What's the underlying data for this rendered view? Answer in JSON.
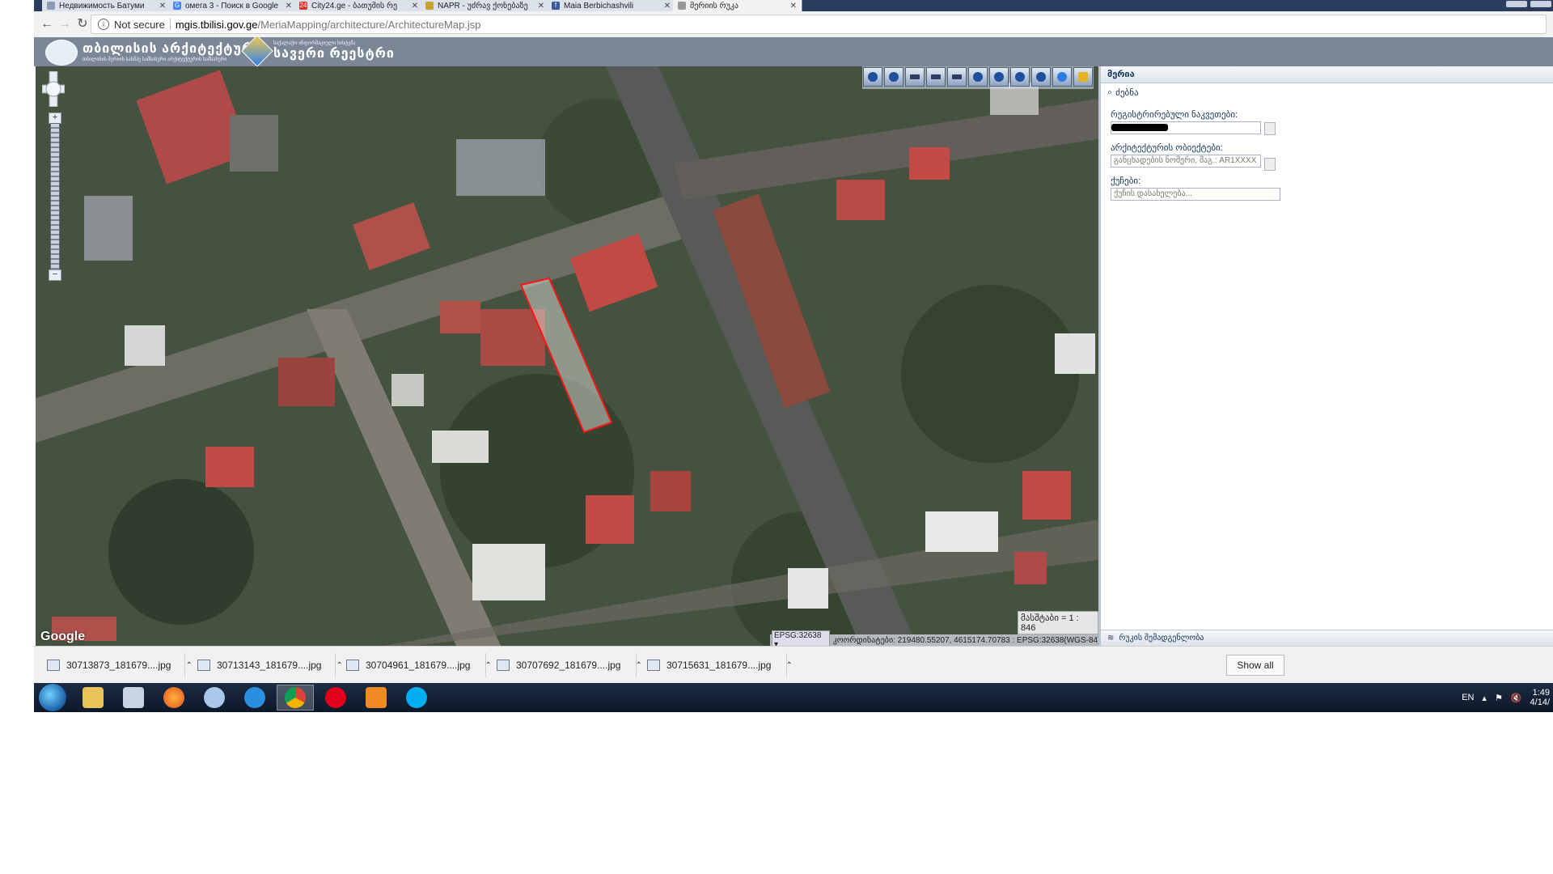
{
  "tabs": [
    {
      "title": "Недвижимость Батуми",
      "fav_color": "#8a9bb3"
    },
    {
      "title": "омега 3 - Поиск в Google",
      "fav_color": "#4285f4"
    },
    {
      "title": "City24.ge - ბათუმის რე",
      "fav_color": "#d93025"
    },
    {
      "title": "NAPR - უძრავ ქონებაზე",
      "fav_color": "#c9a227"
    },
    {
      "title": "Maia Berbichashvili",
      "fav_color": "#3b5998"
    },
    {
      "title": "მერიის რუკა",
      "fav_color": "#999999"
    }
  ],
  "address": {
    "secure_label": "Not secure",
    "host": "mgis.tbilisi.gov.ge",
    "path": "/MeriaMapping/architecture/ArchitectureMap.jsp"
  },
  "header": {
    "logo1_main": "თბილისის არქიტექტურა",
    "logo1_sub": "თბილისის მერიის სასმპე სამსახური არქიტექტურის სამსახური",
    "logo2_main": "სავერი რეესტრი",
    "logo2_sub": "საქალაქო ინფორმაციული სისტემა"
  },
  "map": {
    "google_label": "Google",
    "scale_text": "მასშტაბი = 1 : 846",
    "epsg": "EPSG:32638",
    "coords_text": "კოორდინატები: 219480.55207, 4615174.70783 : EPSG:32638(WGS-84)"
  },
  "panel": {
    "title": "მერია",
    "search_label": "ძებნა",
    "registered_label": "რეგისტრირებული ნაკვეთები:",
    "object_label": "არქიტექტურის ობიექტები:",
    "object_placeholder": "განცხადების ნომერი, მაგ.: AR1XXXX",
    "street_label": "ქუჩები:",
    "street_placeholder": "ქუჩის დასახელება...",
    "footer_label": "რუკის შემადგენლობა"
  },
  "downloads": {
    "files": [
      "30713873_181679....jpg",
      "30713143_181679....jpg",
      "30704961_181679....jpg",
      "30707692_181679....jpg",
      "30715631_181679....jpg"
    ],
    "show_all": "Show all"
  },
  "taskbar": {
    "lang": "EN",
    "time": "1:49",
    "date": "4/14/"
  }
}
